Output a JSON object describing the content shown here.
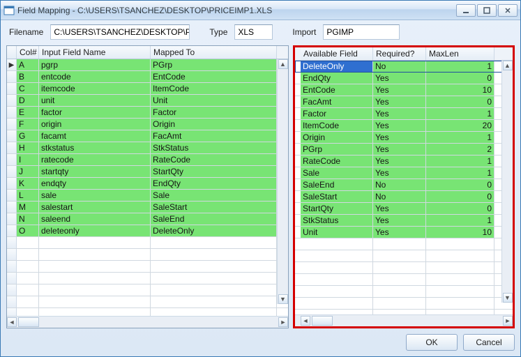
{
  "window": {
    "title": "Field Mapping - C:\\USERS\\TSANCHEZ\\DESKTOP\\PRICEIMP1.XLS"
  },
  "header": {
    "filename_label": "Filename",
    "filename_value": "C:\\USERS\\TSANCHEZ\\DESKTOP\\PRI",
    "type_label": "Type",
    "type_value": "XLS",
    "import_label": "Import",
    "import_value": "PGIMP"
  },
  "left_grid": {
    "columns": {
      "colnum": "Col#",
      "input": "Input Field Name",
      "mapped": "Mapped To"
    },
    "rows": [
      {
        "col": "A",
        "input": "pgrp",
        "mapped": "PGrp"
      },
      {
        "col": "B",
        "input": "entcode",
        "mapped": "EntCode"
      },
      {
        "col": "C",
        "input": "itemcode",
        "mapped": "ItemCode"
      },
      {
        "col": "D",
        "input": "unit",
        "mapped": "Unit"
      },
      {
        "col": "E",
        "input": "factor",
        "mapped": "Factor"
      },
      {
        "col": "F",
        "input": "origin",
        "mapped": "Origin"
      },
      {
        "col": "G",
        "input": "facamt",
        "mapped": "FacAmt"
      },
      {
        "col": "H",
        "input": "stkstatus",
        "mapped": "StkStatus"
      },
      {
        "col": "I",
        "input": "ratecode",
        "mapped": "RateCode"
      },
      {
        "col": "J",
        "input": "startqty",
        "mapped": "StartQty"
      },
      {
        "col": "K",
        "input": "endqty",
        "mapped": "EndQty"
      },
      {
        "col": "L",
        "input": "sale",
        "mapped": "Sale"
      },
      {
        "col": "M",
        "input": "salestart",
        "mapped": "SaleStart"
      },
      {
        "col": "N",
        "input": "saleend",
        "mapped": "SaleEnd"
      },
      {
        "col": "O",
        "input": "deleteonly",
        "mapped": "DeleteOnly"
      }
    ],
    "blank_rows": 7
  },
  "right_grid": {
    "columns": {
      "field": "Available Field",
      "required": "Required?",
      "maxlen": "MaxLen"
    },
    "rows": [
      {
        "field": "DeleteOnly",
        "required": "No",
        "maxlen": "1",
        "sel": true
      },
      {
        "field": "EndQty",
        "required": "Yes",
        "maxlen": "0"
      },
      {
        "field": "EntCode",
        "required": "Yes",
        "maxlen": "10"
      },
      {
        "field": "FacAmt",
        "required": "Yes",
        "maxlen": "0"
      },
      {
        "field": "Factor",
        "required": "Yes",
        "maxlen": "1"
      },
      {
        "field": "ItemCode",
        "required": "Yes",
        "maxlen": "20"
      },
      {
        "field": "Origin",
        "required": "Yes",
        "maxlen": "1"
      },
      {
        "field": "PGrp",
        "required": "Yes",
        "maxlen": "2"
      },
      {
        "field": "RateCode",
        "required": "Yes",
        "maxlen": "1"
      },
      {
        "field": "Sale",
        "required": "Yes",
        "maxlen": "1"
      },
      {
        "field": "SaleEnd",
        "required": "No",
        "maxlen": "0"
      },
      {
        "field": "SaleStart",
        "required": "No",
        "maxlen": "0"
      },
      {
        "field": "StartQty",
        "required": "Yes",
        "maxlen": "0"
      },
      {
        "field": "StkStatus",
        "required": "Yes",
        "maxlen": "1"
      },
      {
        "field": "Unit",
        "required": "Yes",
        "maxlen": "10"
      }
    ],
    "blank_rows": 7
  },
  "buttons": {
    "ok": "OK",
    "cancel": "Cancel"
  }
}
